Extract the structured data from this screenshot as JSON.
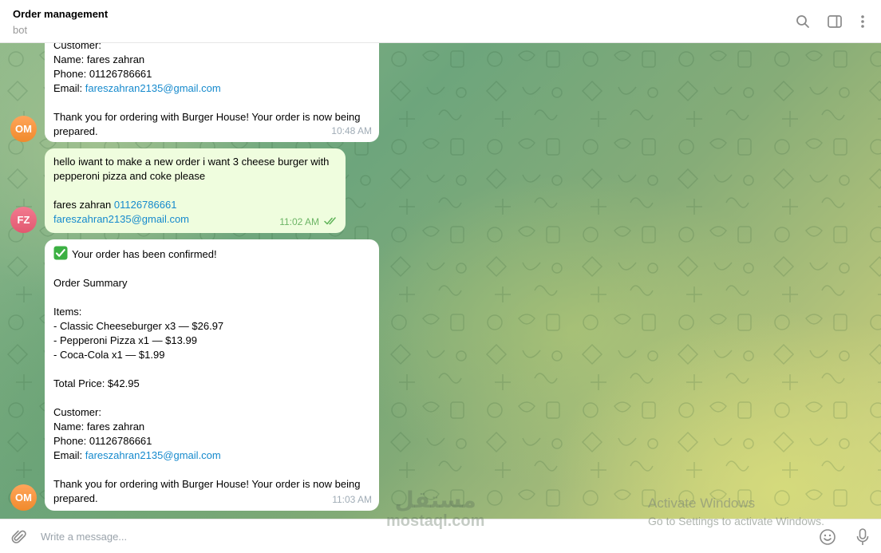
{
  "header": {
    "title": "Order management",
    "subtitle": "bot",
    "icons": [
      "search-icon",
      "sidebar-toggle-icon",
      "more-vertical-icon"
    ]
  },
  "messages": {
    "m1": {
      "sender": "OM",
      "lines": [
        "Customer:",
        "Name: fares zahran",
        "Phone: 01126786661"
      ],
      "email_label": "Email: ",
      "email": "fareszahran2135@gmail.com",
      "thanks": "Thank you for ordering with Burger House! Your order is now being",
      "thanks2": "prepared.",
      "time": "10:48 AM"
    },
    "m2": {
      "sender": "FZ",
      "line1": "hello iwant to make a new order i want 3 cheese burger with",
      "line2": "pepperoni pizza and coke please",
      "name": "fares zahran ",
      "phone": "01126786661",
      "email": "fareszahran2135@gmail.com",
      "time": "11:02 AM",
      "status_icon": "double-check-icon"
    },
    "m3": {
      "sender": "OM",
      "confirm_emoji": "✅",
      "confirm": "Your order has been confirmed!",
      "summary": "Order Summary",
      "items_header": "Items:",
      "items": [
        "- Classic Cheeseburger x3 — $26.97",
        "- Pepperoni Pizza x1 — $13.99",
        "- Coca-Cola x1 — $1.99"
      ],
      "total": "Total Price: $42.95",
      "customer": "Customer:",
      "name": "Name: fares zahran",
      "phone": "Phone: 01126786661",
      "email_label": "Email: ",
      "email": "fareszahran2135@gmail.com",
      "thanks": "Thank you for ordering with Burger House! Your order is now being",
      "thanks2": "prepared.",
      "time": "11:03 AM"
    }
  },
  "composer": {
    "placeholder": "Write a message...",
    "icons": [
      "attach-icon",
      "emoji-icon",
      "microphone-icon"
    ]
  },
  "watermark": {
    "title": "Activate Windows",
    "subtitle": "Go to Settings to activate Windows.",
    "brand_ar": "مستقل",
    "brand_en": "mostaql.com"
  },
  "colors": {
    "link": "#168acd",
    "outgoing_bubble": "#effdde",
    "avatar_om": "#f49a45",
    "avatar_fz": "#e8677d"
  }
}
